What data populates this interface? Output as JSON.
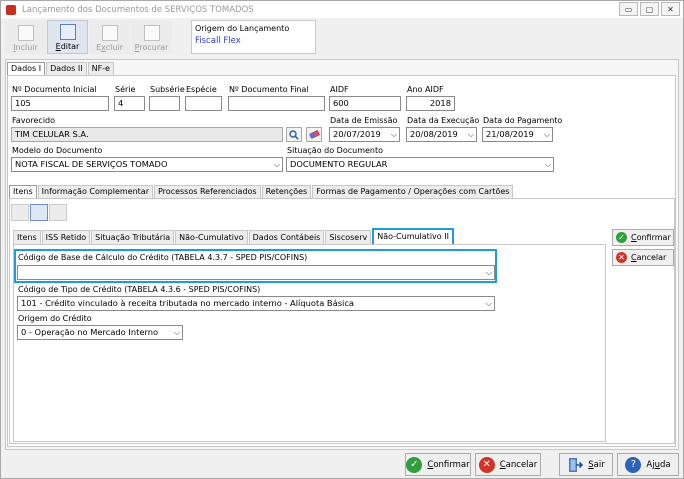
{
  "window": {
    "title": "Lançamento dos Documentos de SERVIÇOS TOMADOS",
    "controls": {
      "minimize": "▭",
      "maximize": "▢",
      "close": "✕"
    }
  },
  "toolbar": {
    "incluir": {
      "u": "I",
      "rest": "ncluir"
    },
    "editar": {
      "u": "E",
      "rest": "ditar"
    },
    "excluir": {
      "pre": "E",
      "u": "x",
      "rest": "cluir"
    },
    "procurar": {
      "u": "P",
      "rest": "rocurar"
    }
  },
  "origem": {
    "label": "Origem do Lançamento",
    "value": "Fiscall Flex"
  },
  "main_tabs": [
    "Dados I",
    "Dados II",
    "NF-e"
  ],
  "form": {
    "numero_inicial": {
      "label": "Nº Documento Inicial",
      "value": "105"
    },
    "serie": {
      "label": "Série",
      "value": "4"
    },
    "subserie": {
      "label": "Subsérie",
      "value": ""
    },
    "especie": {
      "label": "Espécie",
      "value": ""
    },
    "numero_final": {
      "label": "Nº Documento Final",
      "value": ""
    },
    "aidf": {
      "label": "AIDF",
      "value": "600"
    },
    "ano_aidf": {
      "label": "Ano AIDF",
      "value": "2018"
    },
    "favorecido": {
      "label": "Favorecido",
      "value": "TIM CELULAR S.A."
    },
    "data_emissao": {
      "label": "Data de Emissão",
      "value": "20/07/2019"
    },
    "data_execucao": {
      "label": "Data da Execução",
      "value": "20/08/2019"
    },
    "data_pagamento": {
      "label": "Data do Pagamento",
      "value": "21/08/2019"
    },
    "modelo": {
      "label": "Modelo do Documento",
      "value": "NOTA FISCAL DE SERVIÇOS TOMADO"
    },
    "situacao": {
      "label": "Situação do Documento",
      "value": "DOCUMENTO REGULAR"
    }
  },
  "sub_tabs": [
    "Itens",
    "Informação Complementar",
    "Processos Referenciados",
    "Retenções",
    "Formas de Pagamento / Operações com Cartões"
  ],
  "item_tabs": [
    "Itens",
    "ISS Retido",
    "Situação Tributária",
    "Não-Cumulativo",
    "Dados Contábeis",
    "Siscoserv",
    "Não-Cumulativo II"
  ],
  "credito": {
    "base_label": "Código de Base de Cálculo do Crédito (TABELA 4.3.7 - SPED PIS/COFINS)",
    "base_value": "",
    "tipo_label": "Código de Tipo de Crédito (TABELA 4.3.6 - SPED PIS/COFINS)",
    "tipo_value": "101 - Crédito vinculado à receita tributada no mercado interno - Alíquota Básica",
    "origem_label": "Origem do Crédito",
    "origem_value": "0 - Operação no Mercado Interno"
  },
  "side_buttons": {
    "confirmar": {
      "u": "C",
      "rest": "onfirmar"
    },
    "cancelar": {
      "u": "C",
      "rest": "ancelar"
    }
  },
  "bottom_buttons": {
    "confirmar": {
      "u": "C",
      "rest": "onfirmar"
    },
    "cancelar": {
      "u": "C",
      "rest": "ancelar"
    },
    "sair": {
      "u": "S",
      "rest": "air"
    },
    "ajuda": {
      "pre": "Aj",
      "u": "u",
      "rest": "da"
    }
  },
  "colors": {
    "accent_highlight": "#1e9bde",
    "link_blue": "#2d3bd0",
    "confirm_green": "#2f9e3c",
    "cancel_red": "#d23327"
  },
  "glyphs": {
    "dropdown": "⌵",
    "check": "✓",
    "cross": "✕",
    "question": "?"
  }
}
